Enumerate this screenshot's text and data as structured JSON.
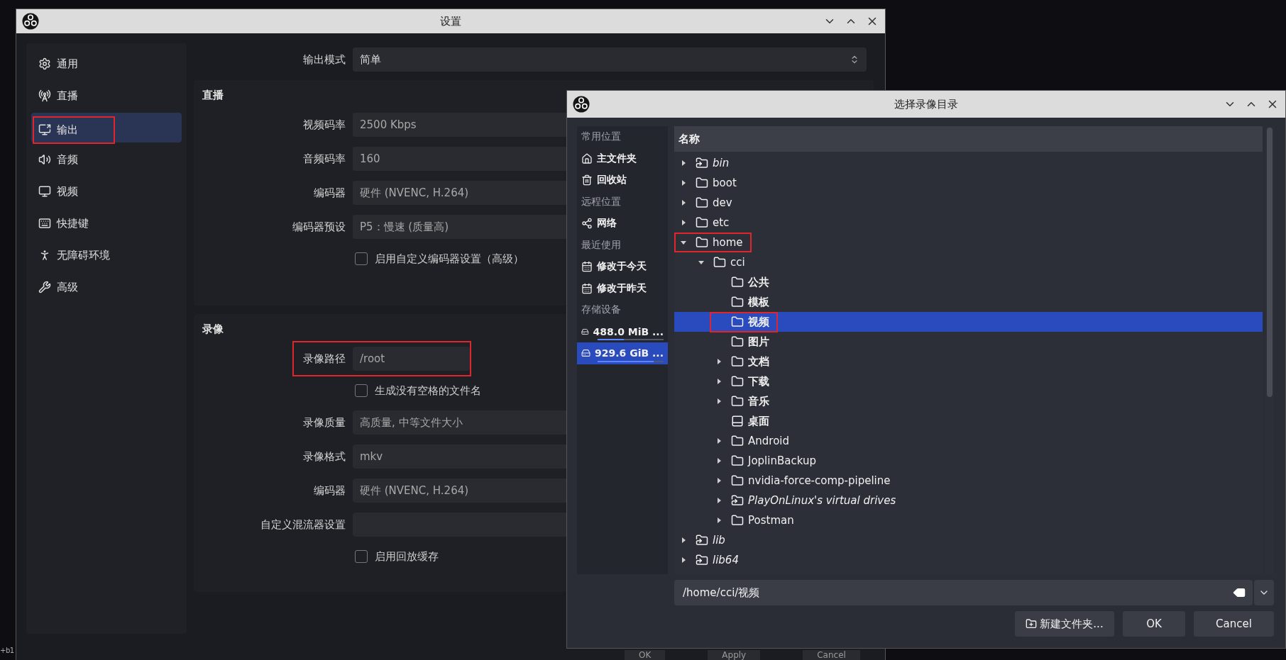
{
  "background_window": {
    "fragment": "+b1"
  },
  "settings": {
    "title": "设置",
    "sidebar": [
      {
        "label": "通用",
        "selected": false,
        "highlighted": false
      },
      {
        "label": "直播",
        "selected": false,
        "highlighted": false
      },
      {
        "label": "输出",
        "selected": true,
        "highlighted": true
      },
      {
        "label": "音频",
        "selected": false,
        "highlighted": false
      },
      {
        "label": "视频",
        "selected": false,
        "highlighted": false
      },
      {
        "label": "快捷键",
        "selected": false,
        "highlighted": false
      },
      {
        "label": "无障碍环境",
        "selected": false,
        "highlighted": false
      },
      {
        "label": "高级",
        "selected": false,
        "highlighted": false
      }
    ],
    "output_mode": {
      "label": "输出模式",
      "value": "简单"
    },
    "streaming": {
      "title": "直播",
      "rows": [
        {
          "kind": "field",
          "label": "视频码率",
          "value": "2500 Kbps",
          "highlighted": false
        },
        {
          "kind": "field",
          "label": "音频码率",
          "value": "160",
          "highlighted": false
        },
        {
          "kind": "field",
          "label": "编码器",
          "value": "硬件 (NVENC, H.264)",
          "highlighted": false
        },
        {
          "kind": "field",
          "label": "编码器预设",
          "value": "P5：慢速 (质量高)",
          "highlighted": false
        },
        {
          "kind": "checkbox",
          "label": "启用自定义编码器设置（高级）",
          "checked": false,
          "highlighted": false
        }
      ]
    },
    "recording": {
      "title": "录像",
      "rows": [
        {
          "kind": "field",
          "label": "录像路径",
          "value": "/root",
          "highlighted": true
        },
        {
          "kind": "checkbox",
          "label": "生成没有空格的文件名",
          "checked": false,
          "highlighted": false
        },
        {
          "kind": "field",
          "label": "录像质量",
          "value": "高质量, 中等文件大小",
          "highlighted": false
        },
        {
          "kind": "field",
          "label": "录像格式",
          "value": "mkv",
          "highlighted": false
        },
        {
          "kind": "field",
          "label": "编码器",
          "value": "硬件 (NVENC, H.264)",
          "highlighted": false
        },
        {
          "kind": "field",
          "label": "自定义混流器设置",
          "highlighted": false
        },
        {
          "kind": "checkbox",
          "label": "启用回放缓存",
          "checked": false,
          "highlighted": false
        }
      ]
    },
    "buttons": [
      "OK",
      "Apply",
      "Cancel"
    ]
  },
  "file_dialog": {
    "title": "选择录像目录",
    "places": [
      {
        "kind": "header",
        "label": "常用位置",
        "selected": false
      },
      {
        "kind": "home",
        "label": "主文件夹",
        "selected": false
      },
      {
        "kind": "trash",
        "label": "回收站",
        "selected": false
      },
      {
        "kind": "header",
        "label": "远程位置",
        "selected": false
      },
      {
        "kind": "network",
        "label": "网络",
        "selected": false
      },
      {
        "kind": "header",
        "label": "最近使用",
        "selected": false
      },
      {
        "kind": "recent",
        "label": "修改于今天",
        "selected": false
      },
      {
        "kind": "recent",
        "label": "修改于昨天",
        "selected": false
      },
      {
        "kind": "header",
        "label": "存储设备",
        "selected": false
      },
      {
        "kind": "drive",
        "label": "488.0 MiB ...",
        "selected": false,
        "level": 0.4
      },
      {
        "kind": "drive",
        "label": "929.6 GiB ...",
        "selected": true,
        "level": 0.85
      }
    ],
    "tree_header": "名称",
    "tree": [
      {
        "name": "bin",
        "kind": "link",
        "expandable": true,
        "expanded": false,
        "selected": false,
        "highlighted": false
      },
      {
        "name": "boot",
        "kind": "folder",
        "expandable": true,
        "expanded": false,
        "selected": false,
        "highlighted": false
      },
      {
        "name": "dev",
        "kind": "folder",
        "expandable": true,
        "expanded": false,
        "selected": false,
        "highlighted": false
      },
      {
        "name": "etc",
        "kind": "folder",
        "expandable": true,
        "expanded": false,
        "selected": false,
        "highlighted": false
      },
      {
        "name": "home",
        "kind": "folder",
        "expandable": true,
        "expanded": true,
        "selected": false,
        "highlighted": true,
        "children": [
          {
            "name": "cci",
            "kind": "folder",
            "expandable": true,
            "expanded": true,
            "selected": false,
            "highlighted": false,
            "children": [
              {
                "name": "公共",
                "kind": "folder",
                "expandable": false,
                "expanded": false,
                "selected": false,
                "highlighted": false
              },
              {
                "name": "模板",
                "kind": "folder",
                "expandable": false,
                "expanded": false,
                "selected": false,
                "highlighted": false
              },
              {
                "name": "视频",
                "kind": "folder",
                "expandable": false,
                "expanded": false,
                "selected": true,
                "highlighted": true
              },
              {
                "name": "图片",
                "kind": "folder",
                "expandable": false,
                "expanded": false,
                "selected": false,
                "highlighted": false
              },
              {
                "name": "文档",
                "kind": "folder",
                "expandable": true,
                "expanded": false,
                "selected": false,
                "highlighted": false
              },
              {
                "name": "下载",
                "kind": "folder",
                "expandable": true,
                "expanded": false,
                "selected": false,
                "highlighted": false
              },
              {
                "name": "音乐",
                "kind": "folder",
                "expandable": true,
                "expanded": false,
                "selected": false,
                "highlighted": false
              },
              {
                "name": "桌面",
                "kind": "desktop",
                "expandable": false,
                "expanded": false,
                "selected": false,
                "highlighted": false
              },
              {
                "name": "Android",
                "kind": "folder",
                "expandable": true,
                "expanded": false,
                "selected": false,
                "highlighted": false
              },
              {
                "name": "JoplinBackup",
                "kind": "folder",
                "expandable": true,
                "expanded": false,
                "selected": false,
                "highlighted": false
              },
              {
                "name": "nvidia-force-comp-pipeline",
                "kind": "folder",
                "expandable": true,
                "expanded": false,
                "selected": false,
                "highlighted": false
              },
              {
                "name": "PlayOnLinux's virtual drives",
                "kind": "link",
                "expandable": true,
                "expanded": false,
                "selected": false,
                "highlighted": false
              },
              {
                "name": "Postman",
                "kind": "folder",
                "expandable": true,
                "expanded": false,
                "selected": false,
                "highlighted": false
              }
            ]
          }
        ]
      },
      {
        "name": "lib",
        "kind": "link",
        "expandable": true,
        "expanded": false,
        "selected": false,
        "highlighted": false
      },
      {
        "name": "lib64",
        "kind": "link",
        "expandable": true,
        "expanded": false,
        "selected": false,
        "highlighted": false
      }
    ],
    "path": "/home/cci/视频",
    "buttons": [
      {
        "kind": "new-folder",
        "label": "新建文件夹..."
      },
      {
        "kind": "plain",
        "label": "OK"
      },
      {
        "kind": "plain",
        "label": "Cancel"
      }
    ]
  }
}
